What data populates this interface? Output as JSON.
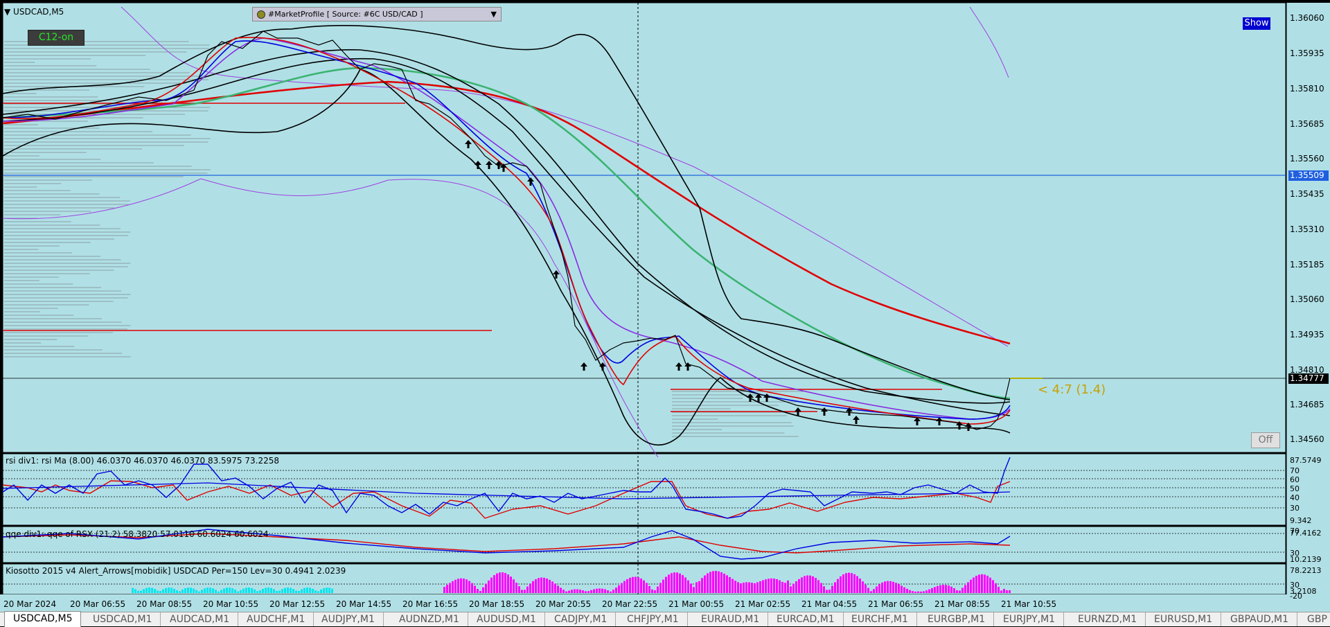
{
  "chart": {
    "symbol_title": "USDCAD,M5",
    "c12_label": "C12-on",
    "market_profile": "#MarketProfile [ Source: #6C USD/CAD ]",
    "show_label": "Show",
    "off_label": "Off",
    "ratio_text": "< 4:7 (1.4)",
    "price_tags": {
      "blue_line": "1.35509",
      "current": "1.34777"
    },
    "y_labels": [
      "1.36060",
      "1.35935",
      "1.35810",
      "1.35685",
      "1.35560",
      "1.35435",
      "1.35310",
      "1.35185",
      "1.35060",
      "1.34935",
      "1.34810",
      "1.34685",
      "1.34560"
    ],
    "x_labels": [
      "20 Mar 2024",
      "20 Mar 06:55",
      "20 Mar 08:55",
      "20 Mar 10:55",
      "20 Mar 12:55",
      "20 Mar 14:55",
      "20 Mar 16:55",
      "20 Mar 18:55",
      "20 Mar 20:55",
      "20 Mar 22:55",
      "21 Mar 00:55",
      "21 Mar 02:55",
      "21 Mar 04:55",
      "21 Mar 06:55",
      "21 Mar 08:55",
      "21 Mar 10:55"
    ]
  },
  "indicators": {
    "rsi": {
      "title": "rsi div1: rsi Ma (8.00) 46.0370 46.0370 46.0370 83.5975 73.2258",
      "levels": [
        "87.5749",
        "70",
        "60",
        "50",
        "40",
        "30",
        "9.342"
      ]
    },
    "qqe": {
      "title": "qqe div1: qqe of RSX (21,2) 58.3820 57.0110 60.6024 60.6024",
      "levels": [
        "77.4162",
        "70",
        "30",
        "10.2139"
      ]
    },
    "kiosotto": {
      "title": "Kiosotto 2015 v4 Alert_Arrows[mobidik] USDCAD Per=150 Lev=30 0.4941 2.0239",
      "levels": [
        "78.2213",
        "30",
        "3.2108",
        "-20"
      ]
    }
  },
  "tabs": [
    "USDCAD,M5",
    "USDCAD,M1",
    "AUDCAD,M1",
    "AUDCHF,M1",
    "AUDJPY,M1",
    "AUDNZD,M1",
    "AUDUSD,M1",
    "CADJPY,M1",
    "CHFJPY,M1",
    "EURAUD,M1",
    "EURCAD,M1",
    "EURCHF,M1",
    "EURGBP,M1",
    "EURJPY,M1",
    "EURNZD,M1",
    "EURUSD,M1",
    "GBPAUD,M1",
    "GBP"
  ],
  "colors": {
    "bg": "#b0e0e6",
    "red": "#e00000",
    "green": "#3cb371",
    "violet": "#9400d3",
    "blue": "#0000e0",
    "magenta": "#ff00ff",
    "cyan": "#00e5ee"
  }
}
